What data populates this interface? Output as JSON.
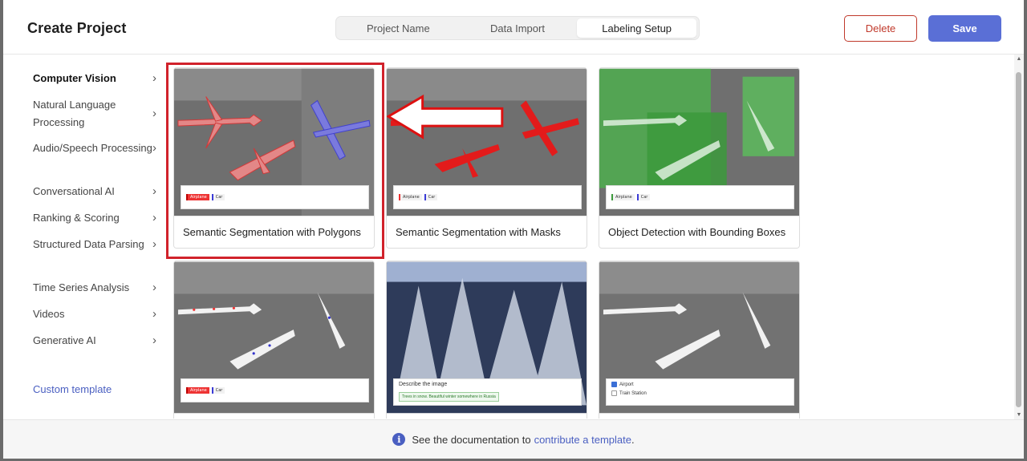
{
  "header": {
    "title": "Create Project",
    "tabs": [
      {
        "label": "Project Name",
        "active": false
      },
      {
        "label": "Data Import",
        "active": false
      },
      {
        "label": "Labeling Setup",
        "active": true
      }
    ],
    "delete_label": "Delete",
    "save_label": "Save"
  },
  "sidebar": {
    "items": [
      {
        "label": "Computer Vision",
        "active": true
      },
      {
        "label": "Natural Language Processing"
      },
      {
        "label": "Audio/Speech Processing"
      },
      {
        "label": "Conversational AI"
      },
      {
        "label": "Ranking & Scoring"
      },
      {
        "label": "Structured Data Parsing"
      },
      {
        "label": "Time Series Analysis"
      },
      {
        "label": "Videos"
      },
      {
        "label": "Generative AI"
      }
    ],
    "custom_template": "Custom template"
  },
  "templates": [
    {
      "title": "Semantic Segmentation with Polygons",
      "chips": [
        "Airplane",
        "Car"
      ],
      "selected": true
    },
    {
      "title": "Semantic Segmentation with Masks",
      "chips": [
        "Airplane",
        "Car"
      ]
    },
    {
      "title": "Object Detection with Bounding Boxes",
      "chips": [
        "Airplane",
        "Car"
      ]
    },
    {
      "title": "",
      "chips": [
        "Airplane",
        "Car"
      ]
    },
    {
      "title": "",
      "prompt": "Describe the image",
      "sample": "Trees in snow. Beautiful winter somewhere in Russia"
    },
    {
      "title": "",
      "options": [
        "Airport",
        "Train Station"
      ]
    }
  ],
  "footer": {
    "text": "See the documentation to",
    "link": "contribute a template",
    "suffix": "."
  },
  "colors": {
    "accent": "#5a6fd6",
    "delete": "#c0392b",
    "highlight": "#d1222b"
  }
}
